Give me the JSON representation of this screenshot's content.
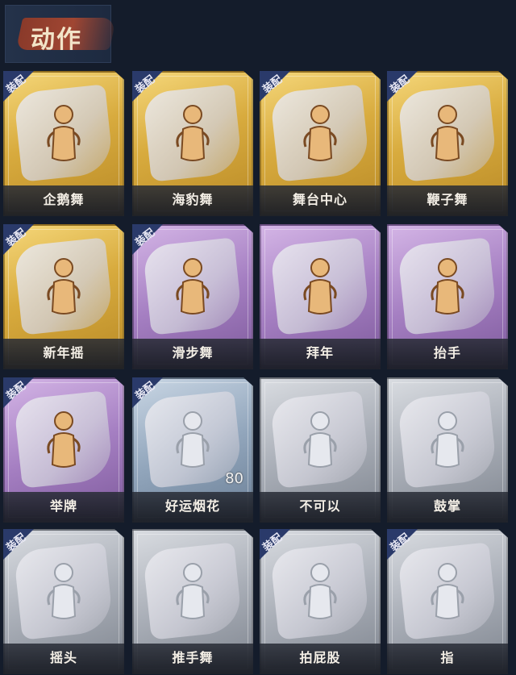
{
  "header": {
    "title": "动作"
  },
  "equip_label": "装配",
  "cards": [
    {
      "name": "企鹅舞",
      "tier": "gold",
      "equipped": true,
      "icon": "figure-gold-icon"
    },
    {
      "name": "海豹舞",
      "tier": "gold",
      "equipped": true,
      "icon": "figure-gold-icon"
    },
    {
      "name": "舞台中心",
      "tier": "gold",
      "equipped": true,
      "icon": "figure-gold-icon"
    },
    {
      "name": "鞭子舞",
      "tier": "gold",
      "equipped": true,
      "icon": "figure-gold-icon"
    },
    {
      "name": "新年摇",
      "tier": "gold",
      "equipped": true,
      "icon": "figure-gold-icon"
    },
    {
      "name": "滑步舞",
      "tier": "purple",
      "equipped": true,
      "icon": "figure-gold-icon"
    },
    {
      "name": "拜年",
      "tier": "purple",
      "equipped": false,
      "icon": "figure-silver-icon"
    },
    {
      "name": "抬手",
      "tier": "purple",
      "equipped": false,
      "icon": "figure-silver-icon"
    },
    {
      "name": "举牌",
      "tier": "purple",
      "equipped": true,
      "icon": "sign-icon"
    },
    {
      "name": "好运烟花",
      "tier": "blue",
      "equipped": true,
      "icon": "firework-icon",
      "count": "80"
    },
    {
      "name": "不可以",
      "tier": "silver",
      "equipped": false,
      "icon": "finger-icon"
    },
    {
      "name": "鼓掌",
      "tier": "silver",
      "equipped": false,
      "icon": "clap-icon"
    },
    {
      "name": "摇头",
      "tier": "silver",
      "equipped": true,
      "icon": "figure-silver-icon"
    },
    {
      "name": "推手舞",
      "tier": "silver",
      "equipped": false,
      "icon": "figure-silver-icon"
    },
    {
      "name": "拍屁股",
      "tier": "silver",
      "equipped": true,
      "icon": "figure-silver-icon"
    },
    {
      "name": "指",
      "tier": "silver",
      "equipped": true,
      "icon": "point-icon"
    }
  ]
}
